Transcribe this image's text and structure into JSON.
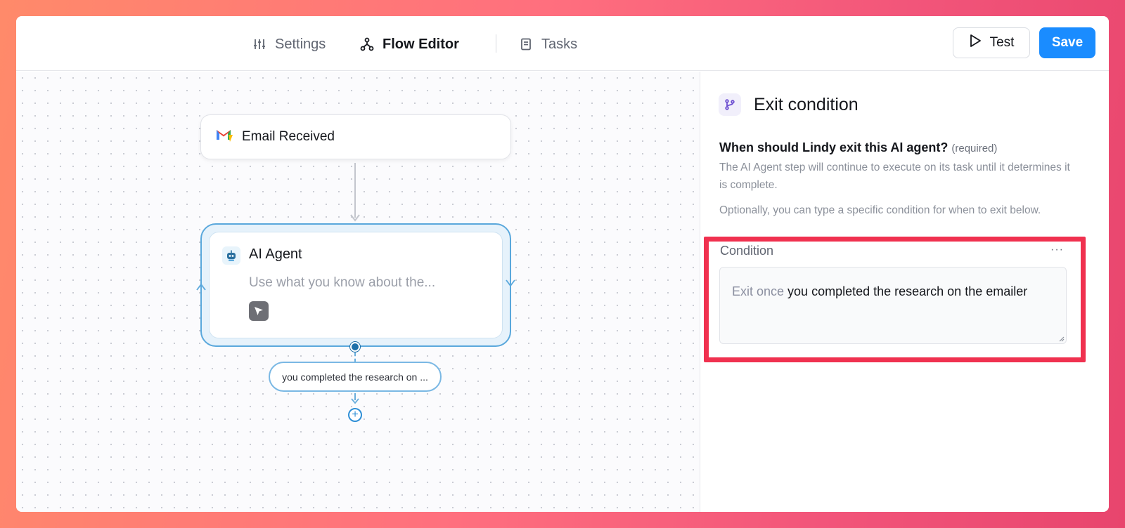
{
  "topbar": {
    "tabs": [
      {
        "label": "Settings",
        "icon": "sliders-icon",
        "active": false
      },
      {
        "label": "Flow Editor",
        "icon": "flow-icon",
        "active": true
      },
      {
        "label": "Tasks",
        "icon": "book-icon",
        "active": false
      }
    ],
    "test_label": "Test",
    "save_label": "Save"
  },
  "canvas": {
    "trigger": {
      "label": "Email Received",
      "icon": "gmail-icon"
    },
    "agent": {
      "title": "AI Agent",
      "description": "Use what you know about the...",
      "icon": "robot-icon",
      "tool_icon": "cursor-icon"
    },
    "exit_condition_pill": "you completed the research on ...",
    "add_step": "+"
  },
  "panel": {
    "title": "Exit condition",
    "icon": "branch-icon",
    "question": "When should Lindy exit this AI agent?",
    "required": "(required)",
    "description1": "The AI Agent step will continue to execute on its task until it determines it is complete.",
    "description2": "Optionally, you can type a specific condition for when to exit below.",
    "condition_label": "Condition",
    "more": "···",
    "condition_prefix": "Exit once",
    "condition_value": " you completed the research on the emailer"
  },
  "colors": {
    "accent": "#1a8cff",
    "highlight": "#f0314f",
    "agent_border": "#5aa8dc"
  }
}
